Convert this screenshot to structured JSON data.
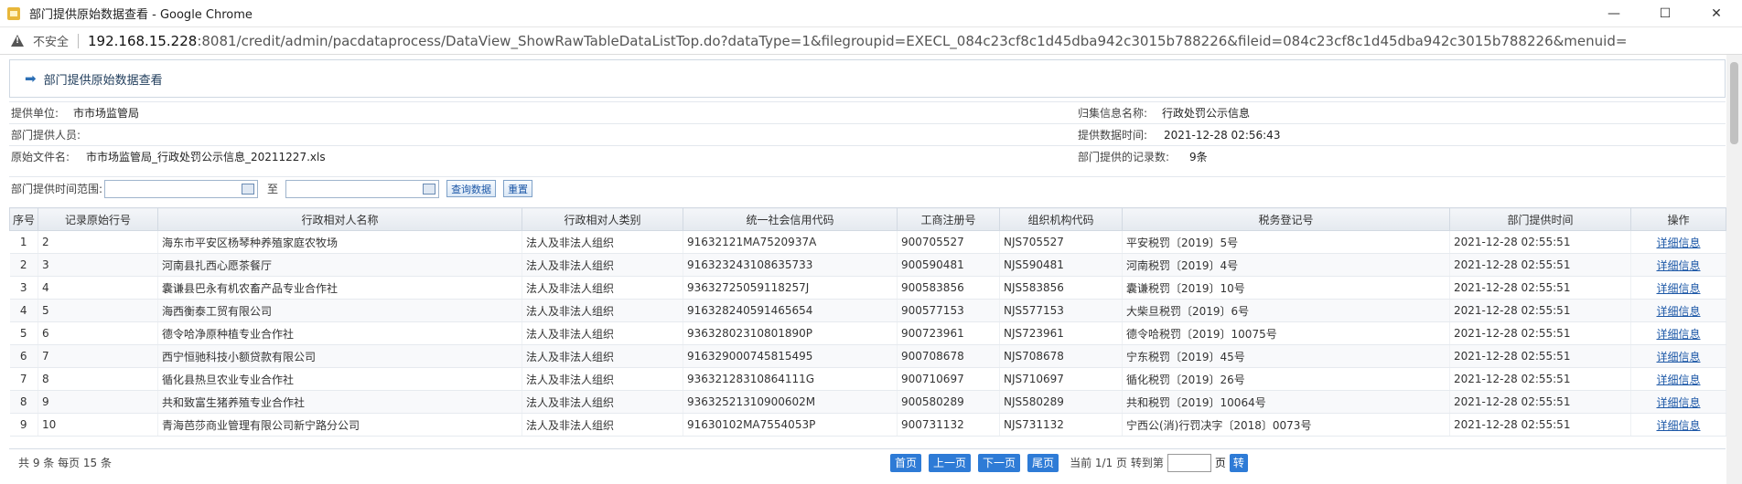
{
  "window": {
    "title": "部门提供原始数据查看 - Google Chrome",
    "controls": {
      "minimize": "—",
      "maximize": "☐",
      "close": "✕"
    }
  },
  "addressbar": {
    "security_label": "不安全",
    "url_host": "192.168.15.228",
    "url_rest": ":8081/credit/admin/pacdataprocess/DataView_ShowRawTableDataListTop.do?dataType=1&filegroupid=EXECL_084c23cf8c1d45dba942c3015b788226&fileid=084c23cf8c1d45dba942c3015b788226&menuid="
  },
  "panel": {
    "title": "部门提供原始数据查看"
  },
  "info": {
    "unit_label": "提供单位:",
    "unit_value": "市市场监管局",
    "collect_label": "归集信息名称:",
    "collect_value": "行政处罚公示信息",
    "person_label": "部门提供人员:",
    "person_value": "",
    "time_label": "提供数据时间:",
    "time_value": "2021-12-28 02:56:43",
    "file_label": "原始文件名:",
    "file_value": "市市场监管局_行政处罚公示信息_20211227.xls",
    "count_label": "部门提供的记录数:",
    "count_value": "9条"
  },
  "filter": {
    "range_label": "部门提供时间范围:",
    "to_label": "至",
    "query_button": "查询数据",
    "reset_button": "重置"
  },
  "table": {
    "headers": [
      "序号",
      "记录原始行号",
      "行政相对人名称",
      "行政相对人类别",
      "统一社会信用代码",
      "工商注册号",
      "组织机构代码",
      "税务登记号",
      "部门提供时间",
      "操作"
    ],
    "rows": [
      [
        "1",
        "2",
        "海东市平安区杨琴种养殖家庭农牧场",
        "法人及非法人组织",
        "91632121MA7520937A",
        "900705527",
        "NJS705527",
        "平安税罚〔2019〕5号",
        "2021-12-28 02:55:51",
        "详细信息"
      ],
      [
        "2",
        "3",
        "河南县扎西心愿茶餐厅",
        "法人及非法人组织",
        "916323243108635733",
        "900590481",
        "NJS590481",
        "河南税罚〔2019〕4号",
        "2021-12-28 02:55:51",
        "详细信息"
      ],
      [
        "3",
        "4",
        "囊谦县巴永有机农畜产品专业合作社",
        "法人及非法人组织",
        "93632725059118257J",
        "900583856",
        "NJS583856",
        "囊谦税罚〔2019〕10号",
        "2021-12-28 02:55:51",
        "详细信息"
      ],
      [
        "4",
        "5",
        "海西衡泰工贸有限公司",
        "法人及非法人组织",
        "916328240591465654",
        "900577153",
        "NJS577153",
        "大柴旦税罚〔2019〕6号",
        "2021-12-28 02:55:51",
        "详细信息"
      ],
      [
        "5",
        "6",
        "德令哈净原种植专业合作社",
        "法人及非法人组织",
        "93632802310801890P",
        "900723961",
        "NJS723961",
        "德令哈税罚〔2019〕10075号",
        "2021-12-28 02:55:51",
        "详细信息"
      ],
      [
        "6",
        "7",
        "西宁恒驰科技小额贷款有限公司",
        "法人及非法人组织",
        "916329000745815495",
        "900708678",
        "NJS708678",
        "宁东税罚〔2019〕45号",
        "2021-12-28 02:55:51",
        "详细信息"
      ],
      [
        "7",
        "8",
        "循化县热旦农业专业合作社",
        "法人及非法人组织",
        "93632128310864111G",
        "900710697",
        "NJS710697",
        "循化税罚〔2019〕26号",
        "2021-12-28 02:55:51",
        "详细信息"
      ],
      [
        "8",
        "9",
        "共和致富生猪养殖专业合作社",
        "法人及非法人组织",
        "93632521310900602M",
        "900580289",
        "NJS580289",
        "共和税罚〔2019〕10064号",
        "2021-12-28 02:55:51",
        "详细信息"
      ],
      [
        "9",
        "10",
        "青海芭莎商业管理有限公司新宁路分公司",
        "法人及非法人组织",
        "91630102MA7554053P",
        "900731132",
        "NJS731132",
        "宁西公(消)行罚决字〔2018〕0073号",
        "2021-12-28 02:55:51",
        "详细信息"
      ]
    ]
  },
  "pager": {
    "summary": "共 9 条  每页  15  条",
    "first": "首页",
    "prev": "上一页",
    "next": "下一页",
    "last": "尾页",
    "current": "当前 1/1 页  转到第",
    "page_unit": "页",
    "go": "转"
  }
}
